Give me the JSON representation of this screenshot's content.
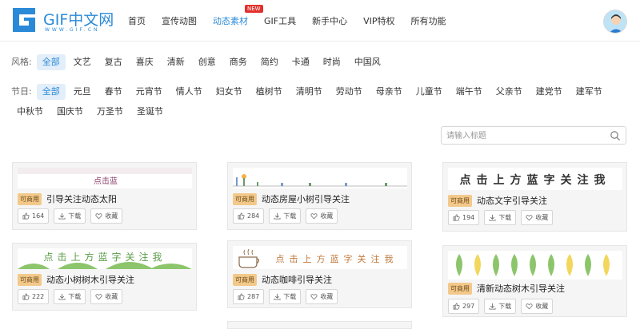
{
  "brand": {
    "name": "GIF中文网",
    "url_text": "WWW.GIF.CN"
  },
  "nav": [
    {
      "label": "首页"
    },
    {
      "label": "宣传动图"
    },
    {
      "label": "动态素材",
      "active": true,
      "badge": "NEW"
    },
    {
      "label": "GIF工具"
    },
    {
      "label": "新手中心"
    },
    {
      "label": "VIP特权"
    },
    {
      "label": "所有功能"
    }
  ],
  "filters": {
    "style": {
      "label": "风格:",
      "options": [
        "全部",
        "文艺",
        "复古",
        "喜庆",
        "清新",
        "创意",
        "商务",
        "简约",
        "卡通",
        "时尚",
        "中国风"
      ],
      "selected": "全部"
    },
    "festival": {
      "label": "节日:",
      "options": [
        "全部",
        "元旦",
        "春节",
        "元宵节",
        "情人节",
        "妇女节",
        "植树节",
        "清明节",
        "劳动节",
        "母亲节",
        "儿童节",
        "端午节",
        "父亲节",
        "建党节",
        "建军节",
        "中秋节",
        "国庆节",
        "万圣节",
        "圣诞节"
      ],
      "selected": "全部"
    }
  },
  "search": {
    "placeholder": "请输入标题",
    "value": ""
  },
  "cards": [
    {
      "tag": "可商用",
      "title": "引导关注动态太阳",
      "likes": "164",
      "download": "下载",
      "favorite": "收藏",
      "thumb_text": "点击蓝"
    },
    {
      "tag": "可商用",
      "title": "动态房屋小树引导关注",
      "likes": "284",
      "download": "下载",
      "favorite": "收藏",
      "thumb_text": ""
    },
    {
      "tag": "可商用",
      "title": "动态文字引导关注",
      "likes": "194",
      "download": "下载",
      "favorite": "收藏",
      "thumb_text": "点击上方蓝字关注我"
    },
    {
      "tag": "可商用",
      "title": "动态小树树木引导关注",
      "likes": "222",
      "download": "下载",
      "favorite": "收藏",
      "thumb_text": "点击上方蓝字关注我"
    },
    {
      "tag": "可商用",
      "title": "动态咖啡引导关注",
      "likes": "287",
      "download": "下载",
      "favorite": "收藏",
      "thumb_text": "点击上方蓝字关注我"
    },
    {
      "tag": "可商用",
      "title": "清新动态树木引导关注",
      "likes": "297",
      "download": "下载",
      "favorite": "收藏",
      "thumb_text": ""
    }
  ],
  "colors": {
    "accent": "#2b8ad8",
    "badge": "#e2312d",
    "tag": "#f3c98b"
  }
}
